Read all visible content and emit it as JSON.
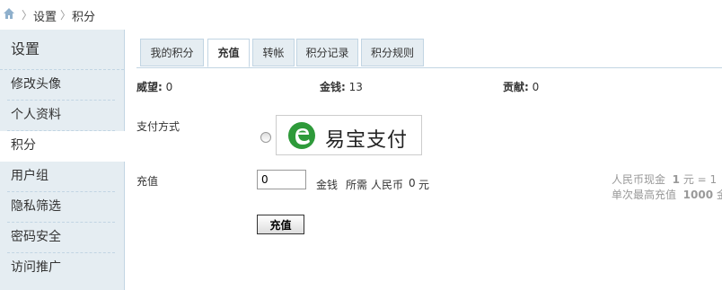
{
  "breadcrumb": {
    "home_icon": "home-icon",
    "sep": "〉",
    "items": [
      "设置",
      "积分"
    ]
  },
  "sidebar": {
    "title": "设置",
    "items": [
      {
        "label": "修改头像"
      },
      {
        "label": "个人资料"
      },
      {
        "label": "积分",
        "active": true
      },
      {
        "label": "用户组"
      },
      {
        "label": "隐私筛选"
      },
      {
        "label": "密码安全"
      },
      {
        "label": "访问推广"
      }
    ]
  },
  "tabs": [
    {
      "label": "我的积分"
    },
    {
      "label": "充值",
      "active": true
    },
    {
      "label": "转帐"
    },
    {
      "label": "积分记录"
    },
    {
      "label": "积分规则"
    }
  ],
  "stats": {
    "prestige_label": "威望:",
    "prestige_value": "0",
    "money_label": "金钱:",
    "money_value": "13",
    "contribution_label": "贡献:",
    "contribution_value": "0"
  },
  "payment": {
    "label": "支付方式",
    "option_name": "易宝支付",
    "logo_icon": "yeepay-logo-icon"
  },
  "recharge": {
    "label": "充值",
    "amount_value": "0",
    "unit": "金钱",
    "required_label": "所需",
    "currency": "人民币",
    "cost_value": "0",
    "cost_unit": "元",
    "rate_note_prefix": "人民币现金",
    "rate_note_value": "1",
    "rate_note_suffix": "元 = 1",
    "max_note_prefix": "单次最高充值",
    "max_note_value": "1000",
    "max_note_suffix": "金"
  },
  "submit_label": "充值",
  "colors": {
    "sidebar_bg": "#e5edf2",
    "border": "#c2d5e3",
    "logo_green": "#2e9a3a"
  }
}
